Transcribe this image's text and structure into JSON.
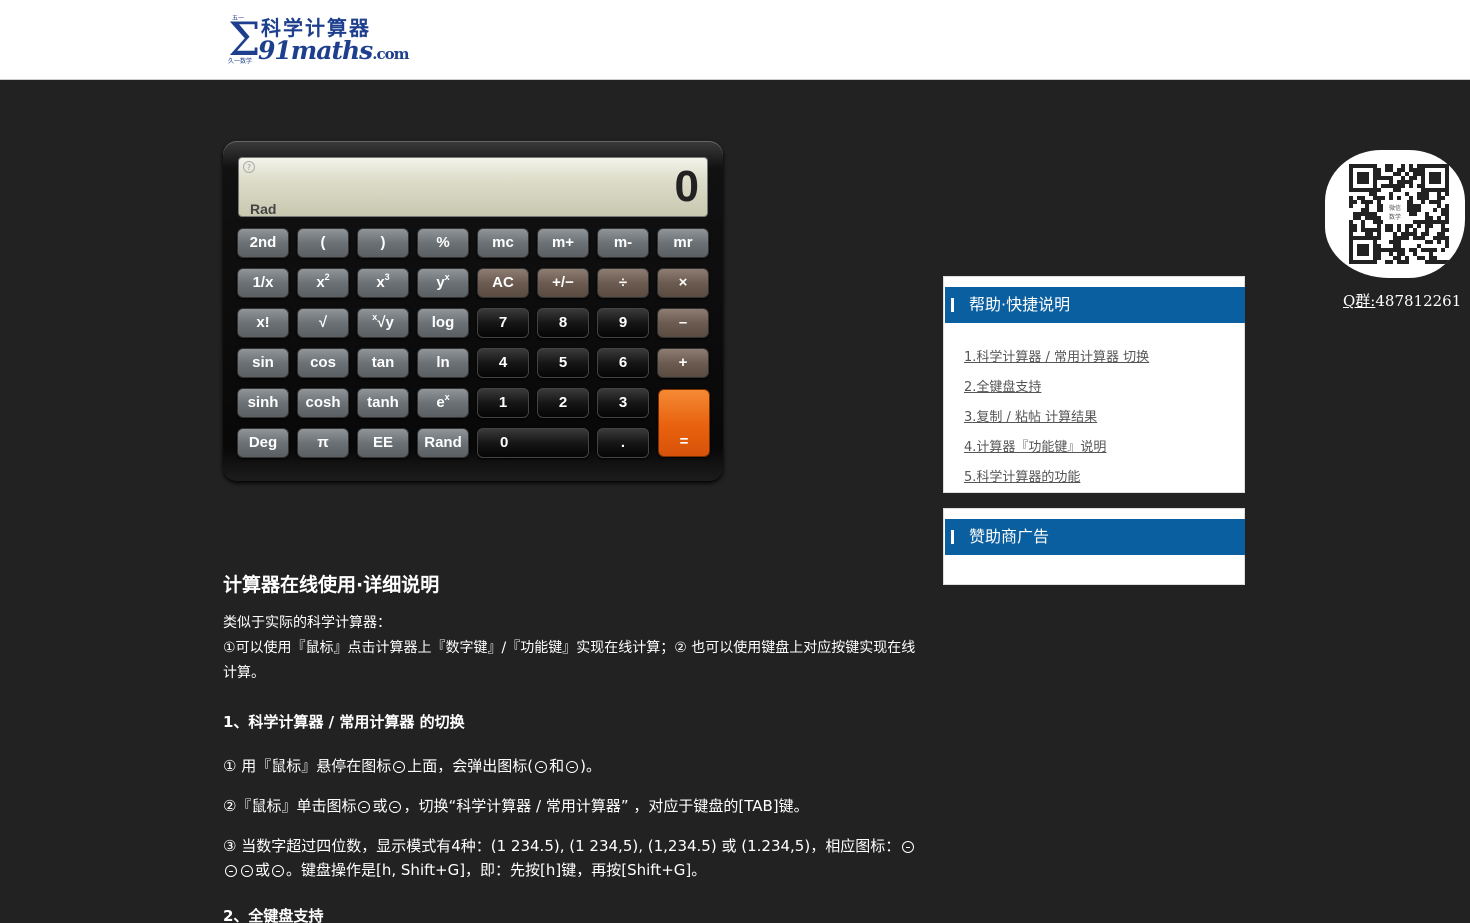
{
  "header": {
    "logo_cn": "科学计算器",
    "logo_site": "91maths",
    "logo_tld": ".com",
    "logo_tiny_top": "五一",
    "logo_tiny_side": "久一数学"
  },
  "calculator": {
    "help_glyph": "?",
    "mode": "Rad",
    "display_value": "0",
    "rows": [
      [
        {
          "t": "2nd",
          "c": "gray"
        },
        {
          "t": "(",
          "c": "gray"
        },
        {
          "t": ")",
          "c": "gray"
        },
        {
          "t": "%",
          "c": "gray"
        },
        {
          "t": "mc",
          "c": "gray"
        },
        {
          "t": "m+",
          "c": "gray"
        },
        {
          "t": "m-",
          "c": "gray"
        },
        {
          "t": "mr",
          "c": "gray"
        }
      ],
      [
        {
          "t": "1/x",
          "c": "gray"
        },
        {
          "t": "x",
          "sup": "2",
          "c": "gray"
        },
        {
          "t": "x",
          "sup": "3",
          "c": "gray"
        },
        {
          "t": "y",
          "sup": "x",
          "c": "gray"
        },
        {
          "t": "AC",
          "c": "brown"
        },
        {
          "t": "+/−",
          "c": "brown"
        },
        {
          "t": "÷",
          "c": "brown"
        },
        {
          "t": "×",
          "c": "brown"
        }
      ],
      [
        {
          "t": "x!",
          "c": "gray"
        },
        {
          "t": "√",
          "c": "gray"
        },
        {
          "t": "√y",
          "sup": "x",
          "pre": true,
          "c": "gray"
        },
        {
          "t": "log",
          "c": "gray"
        },
        {
          "t": "7",
          "c": "black"
        },
        {
          "t": "8",
          "c": "black"
        },
        {
          "t": "9",
          "c": "black"
        },
        {
          "t": "–",
          "c": "brown"
        }
      ],
      [
        {
          "t": "sin",
          "c": "gray"
        },
        {
          "t": "cos",
          "c": "gray"
        },
        {
          "t": "tan",
          "c": "gray"
        },
        {
          "t": "ln",
          "c": "gray"
        },
        {
          "t": "4",
          "c": "black"
        },
        {
          "t": "5",
          "c": "black"
        },
        {
          "t": "6",
          "c": "black"
        },
        {
          "t": "+",
          "c": "brown"
        }
      ],
      [
        {
          "t": "sinh",
          "c": "gray"
        },
        {
          "t": "cosh",
          "c": "gray"
        },
        {
          "t": "tanh",
          "c": "gray"
        },
        {
          "t": "e",
          "sup": "x",
          "c": "gray"
        },
        {
          "t": "1",
          "c": "black"
        },
        {
          "t": "2",
          "c": "black"
        },
        {
          "t": "3",
          "c": "black"
        }
      ],
      [
        {
          "t": "Deg",
          "c": "gray"
        },
        {
          "t": "π",
          "c": "gray"
        },
        {
          "t": "EE",
          "c": "gray"
        },
        {
          "t": "Rand",
          "c": "gray"
        },
        {
          "t": "0",
          "c": "black",
          "wide": true
        },
        {
          "t": ".",
          "c": "black"
        }
      ]
    ],
    "equals": "="
  },
  "article": {
    "title": "计算器在线使用·详细说明",
    "intro1": "类似于实际的科学计算器：",
    "intro2": "①可以使用『鼠标』点击计算器上『数字键』/『功能键』实现在线计算；② 也可以使用键盘上对应按键实现在线计算。",
    "section1": "1、科学计算器 / 常用计算器 的切换",
    "s1_p1_a": "① 用『鼠标』悬停在图标",
    "s1_p1_b": "上面，会弹出图标(",
    "s1_p1_c": "和",
    "s1_p1_d": ")。",
    "s1_p2_a": "②『鼠标』单击图标",
    "s1_p2_b": "或",
    "s1_p2_c": "，切换“科学计算器 / 常用计算器” ，对应于键盘的[TAB]键。",
    "s1_p3_a": "③ 当数字超过四位数，显示模式有4种：(1 234.5), (1 234,5), (1,234.5) 或 (1.234,5)，相应图标：",
    "s1_p3_b": "或",
    "s1_p3_c": "。键盘操作是[h, Shift+G]，即：先按[h]键，再按[Shift+G]。",
    "section2": "2、全键盘支持"
  },
  "sidebar": {
    "help_title": "帮助·快捷说明",
    "help_items": [
      "1.科学计算器 / 常用计算器 切换",
      "2.全键盘支持",
      "3.复制 / 粘帖 计算结果",
      "4.计算器『功能键』说明",
      "5.科学计算器的功能"
    ],
    "ad_title": "赞助商广告"
  },
  "qr": {
    "label": "Q群:",
    "number": "487812261",
    "center_text": "数学"
  }
}
